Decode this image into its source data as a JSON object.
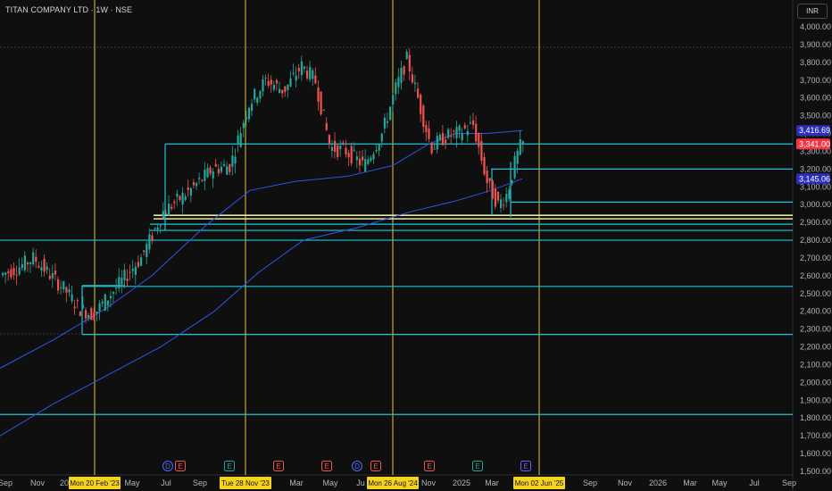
{
  "header": {
    "title": "TITAN COMPANY LTD · 1W · NSE",
    "currency": "INR"
  },
  "colors": {
    "background": "#0f0f0f",
    "up_candle": "#26a69a",
    "down_candle": "#ef5350",
    "zone_line": "#1fc3d6",
    "ma_line": "#2f55e8",
    "event_line": "#e0c73a",
    "current_price": "#f23645",
    "ma_badge": "#2b2fb8"
  },
  "chart_data": {
    "type": "candlestick",
    "y_axis": {
      "ylim": [
        1500,
        4100
      ],
      "ticks": [
        "4,000.00",
        "3,900.00",
        "3,800.00",
        "3,700.00",
        "3,600.00",
        "3,500.00",
        "3,400.00",
        "3,300.00",
        "3,200.00",
        "3,100.00",
        "3,000.00",
        "2,900.00",
        "2,800.00",
        "2,700.00",
        "2,600.00",
        "2,500.00",
        "2,400.00",
        "2,300.00",
        "2,200.00",
        "2,100.00",
        "2,000.00",
        "1,900.00",
        "1,800.00",
        "1,700.00",
        "1,600.00",
        "1,500.00"
      ]
    },
    "x_axis": {
      "ticks": [
        "Sep",
        "Nov",
        "20",
        "May",
        "Jul",
        "Sep",
        "Mar",
        "May",
        "Ju",
        "Nov",
        "2025",
        "Mar",
        "Sep",
        "Nov",
        "2026",
        "Mar",
        "May",
        "Jul",
        "Sep"
      ],
      "highlighted_dates": [
        "Mon 20 Feb '23",
        "Tue 28 Nov '23",
        "Mon 26 Aug '24",
        "Mon 02 Jun '25"
      ]
    },
    "price_labels": [
      {
        "value": 3416.69,
        "text": "3,416.69",
        "kind": "moving-average"
      },
      {
        "value": 3341.0,
        "text": "3,341.00",
        "kind": "last-price"
      },
      {
        "value": 3145.06,
        "text": "3,145.06",
        "kind": "moving-average"
      }
    ],
    "horizontal_levels": [
      3341,
      3200,
      3014,
      2940,
      2920,
      2890,
      2855,
      2800,
      2540,
      2270,
      1820
    ],
    "zone_boxes": [
      {
        "start": "Feb '23",
        "top": 2545,
        "bottom": 2270
      },
      {
        "start": "Jul '23",
        "top": 3340,
        "bottom": 2855
      },
      {
        "start": "Feb '25",
        "top": 3200,
        "bottom": 2940
      },
      {
        "start": "Mar '25",
        "top": 3240,
        "bottom": 2930
      }
    ],
    "event_markers": [
      "D",
      "E",
      "E",
      "E",
      "E",
      "D",
      "E",
      "E",
      "E",
      "E"
    ]
  }
}
